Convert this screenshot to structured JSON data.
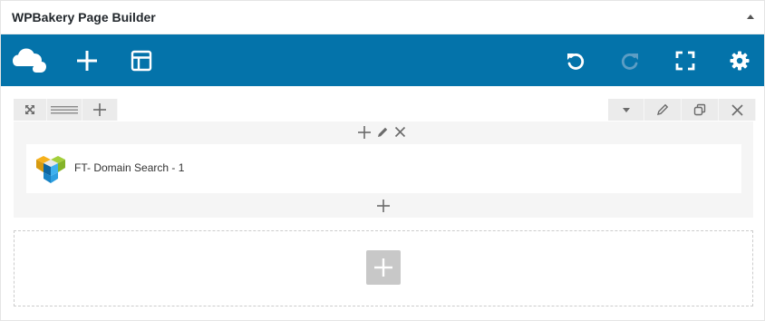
{
  "panel": {
    "title": "WPBakery Page Builder"
  },
  "navbar": {
    "brand_color": "#0473aa",
    "left_icons": [
      "logo-icon",
      "add-element-icon",
      "templates-icon"
    ],
    "right_icons": [
      "undo-icon",
      "redo-icon",
      "fullscreen-icon",
      "settings-icon"
    ]
  },
  "row": {
    "left_controls": [
      "expand-icon",
      "layout-icon",
      "add-icon"
    ],
    "right_controls": [
      "toggle-icon",
      "edit-icon",
      "clone-icon",
      "delete-icon"
    ],
    "column_controls": [
      "add-icon",
      "edit-icon",
      "delete-icon"
    ],
    "element": {
      "label": "FT- Domain Search - 1",
      "icon": "visual-composer-logo-icon"
    }
  },
  "empty_row": {
    "icon": "add-icon"
  }
}
